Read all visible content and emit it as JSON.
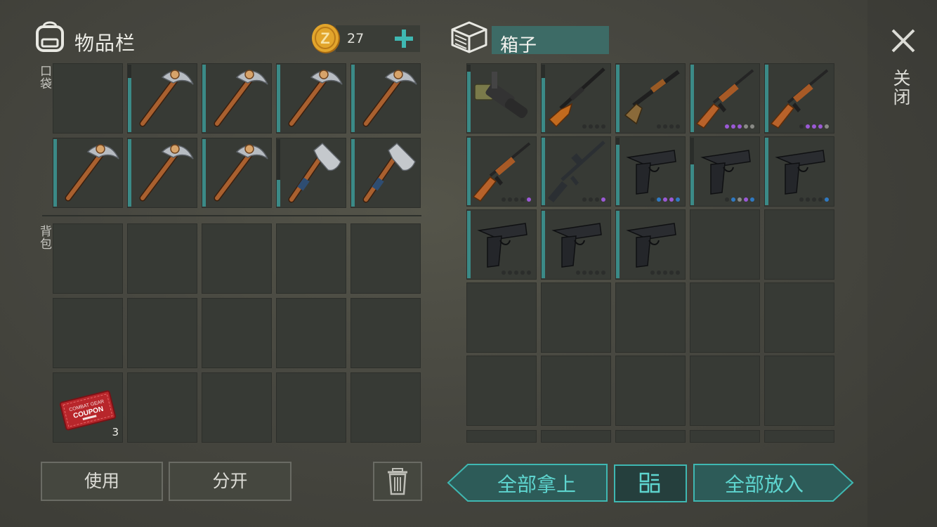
{
  "inventory": {
    "title": "物品栏",
    "coins": "27",
    "pocket_label": "口袋",
    "backpack_label": "背包"
  },
  "container": {
    "title": "箱子",
    "close_label": "关闭"
  },
  "pocket": [
    {
      "item": null
    },
    {
      "item": "pickaxe",
      "durability": 0.8
    },
    {
      "item": "pickaxe",
      "durability": 1.0
    },
    {
      "item": "pickaxe",
      "durability": 1.0
    },
    {
      "item": "pickaxe",
      "durability": 1.0
    },
    {
      "item": "pickaxe",
      "durability": 1.0
    },
    {
      "item": "pickaxe",
      "durability": 1.0
    },
    {
      "item": "pickaxe",
      "durability": 1.0
    },
    {
      "item": "hatchet",
      "durability": 0.4
    },
    {
      "item": "hatchet",
      "durability": 1.0
    }
  ],
  "backpack": [
    {
      "item": null
    },
    {
      "item": null
    },
    {
      "item": null
    },
    {
      "item": null
    },
    {
      "item": null
    },
    {
      "item": null
    },
    {
      "item": null
    },
    {
      "item": null
    },
    {
      "item": null
    },
    {
      "item": null
    },
    {
      "item": "coupon",
      "quantity": "3",
      "coupon_text": [
        "COMBAT GEAR",
        "COUPON"
      ]
    },
    {
      "item": null
    },
    {
      "item": null
    },
    {
      "item": null
    },
    {
      "item": null
    }
  ],
  "box": [
    {
      "item": "grenade-launcher",
      "durability": 0.9,
      "dots": []
    },
    {
      "item": "sniper-rifle",
      "durability": 0.8,
      "dots": [
        "#2b2d2b",
        "#2b2d2b",
        "#2b2d2b",
        "#2b2d2b"
      ]
    },
    {
      "item": "shotgun",
      "durability": 1.0,
      "dots": [
        "#2b2d2b",
        "#2b2d2b",
        "#2b2d2b",
        "#2b2d2b"
      ]
    },
    {
      "item": "ak-rifle",
      "durability": 1.0,
      "dots": [
        "#9b59d6",
        "#9b59d6",
        "#9b59d6",
        "#8a8a86",
        "#8a8a86"
      ]
    },
    {
      "item": "ak-rifle",
      "durability": 1.0,
      "dots": [
        "#2b2d2b",
        "#9b59d6",
        "#9b59d6",
        "#9b59d6",
        "#8a8a86"
      ]
    },
    {
      "item": "ak-rifle",
      "durability": 1.0,
      "dots": [
        "#2b2d2b",
        "#2b2d2b",
        "#2b2d2b",
        "#2b2d2b",
        "#9b59d6"
      ]
    },
    {
      "item": "m16-rifle",
      "durability": 1.0,
      "dots": [
        "#2b2d2b",
        "#2b2d2b",
        "#2b2d2b",
        "#9b59d6"
      ]
    },
    {
      "item": "pistol",
      "durability": 0.9,
      "dots": [
        "#2b2d2b",
        "#2f79c2",
        "#9b59d6",
        "#9b59d6",
        "#2f79c2"
      ]
    },
    {
      "item": "pistol",
      "durability": 0.6,
      "dots": [
        "#2b2d2b",
        "#2f79c2",
        "#8a8a86",
        "#9b59d6",
        "#2f79c2"
      ]
    },
    {
      "item": "pistol",
      "durability": 1.0,
      "dots": [
        "#2b2d2b",
        "#2b2d2b",
        "#2b2d2b",
        "#2b2d2b",
        "#2f79c2"
      ]
    },
    {
      "item": "pistol",
      "durability": 1.0,
      "dots": [
        "#2b2d2b",
        "#2b2d2b",
        "#2b2d2b",
        "#2b2d2b",
        "#2b2d2b"
      ]
    },
    {
      "item": "pistol",
      "durability": 1.0,
      "dots": [
        "#2b2d2b",
        "#2b2d2b",
        "#2b2d2b",
        "#2b2d2b",
        "#2b2d2b"
      ]
    },
    {
      "item": "pistol",
      "durability": 1.0,
      "dots": [
        "#2b2d2b",
        "#2b2d2b",
        "#2b2d2b",
        "#2b2d2b",
        "#2b2d2b"
      ]
    },
    {
      "item": null
    },
    {
      "item": null
    },
    {
      "item": null
    },
    {
      "item": null
    },
    {
      "item": null
    },
    {
      "item": null
    },
    {
      "item": null
    },
    {
      "item": null
    },
    {
      "item": null
    },
    {
      "item": null
    },
    {
      "item": null
    },
    {
      "item": null
    }
  ],
  "buttons": {
    "use": "使用",
    "split": "分开",
    "take_all": "全部拿上",
    "put_all": "全部放入"
  },
  "colors": {
    "accent": "#3b8a87",
    "teal_text": "#5ed5cf",
    "purple": "#9b59d6",
    "blue": "#2f79c2"
  }
}
